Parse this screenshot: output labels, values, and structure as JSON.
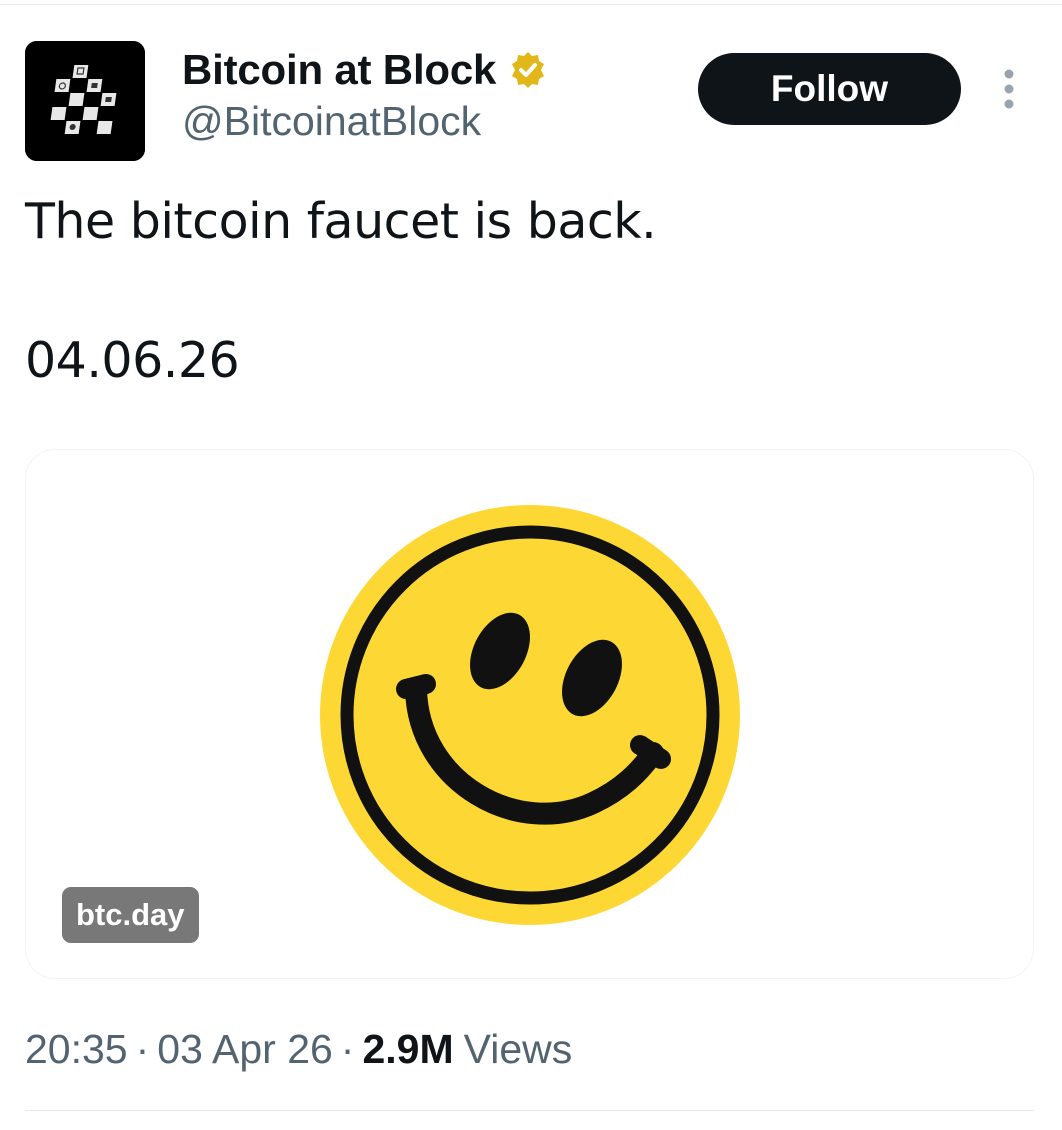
{
  "author": {
    "display_name": "Bitcoin at Block",
    "handle": "@BitcoinatBlock",
    "avatar_icon": "checkerboard-logo-icon",
    "verified_icon": "gold-verified-badge-icon",
    "verified_color": "#E2B719"
  },
  "header": {
    "follow_label": "Follow",
    "more_icon": "vertical-ellipsis-icon"
  },
  "tweet": {
    "text": "The bitcoin faucet is back.",
    "date_line": "04.06.26"
  },
  "media": {
    "image_icon": "smiley-face-icon",
    "link_label": "btc.day",
    "smiley_color": "#FDD835"
  },
  "meta": {
    "time": "20:35",
    "separator": "·",
    "date": "03 Apr 26",
    "views_count": "2.9M",
    "views_label": "Views"
  },
  "colors": {
    "text_primary": "#0F1419",
    "text_secondary": "#536471",
    "button_bg": "#0F1419"
  }
}
